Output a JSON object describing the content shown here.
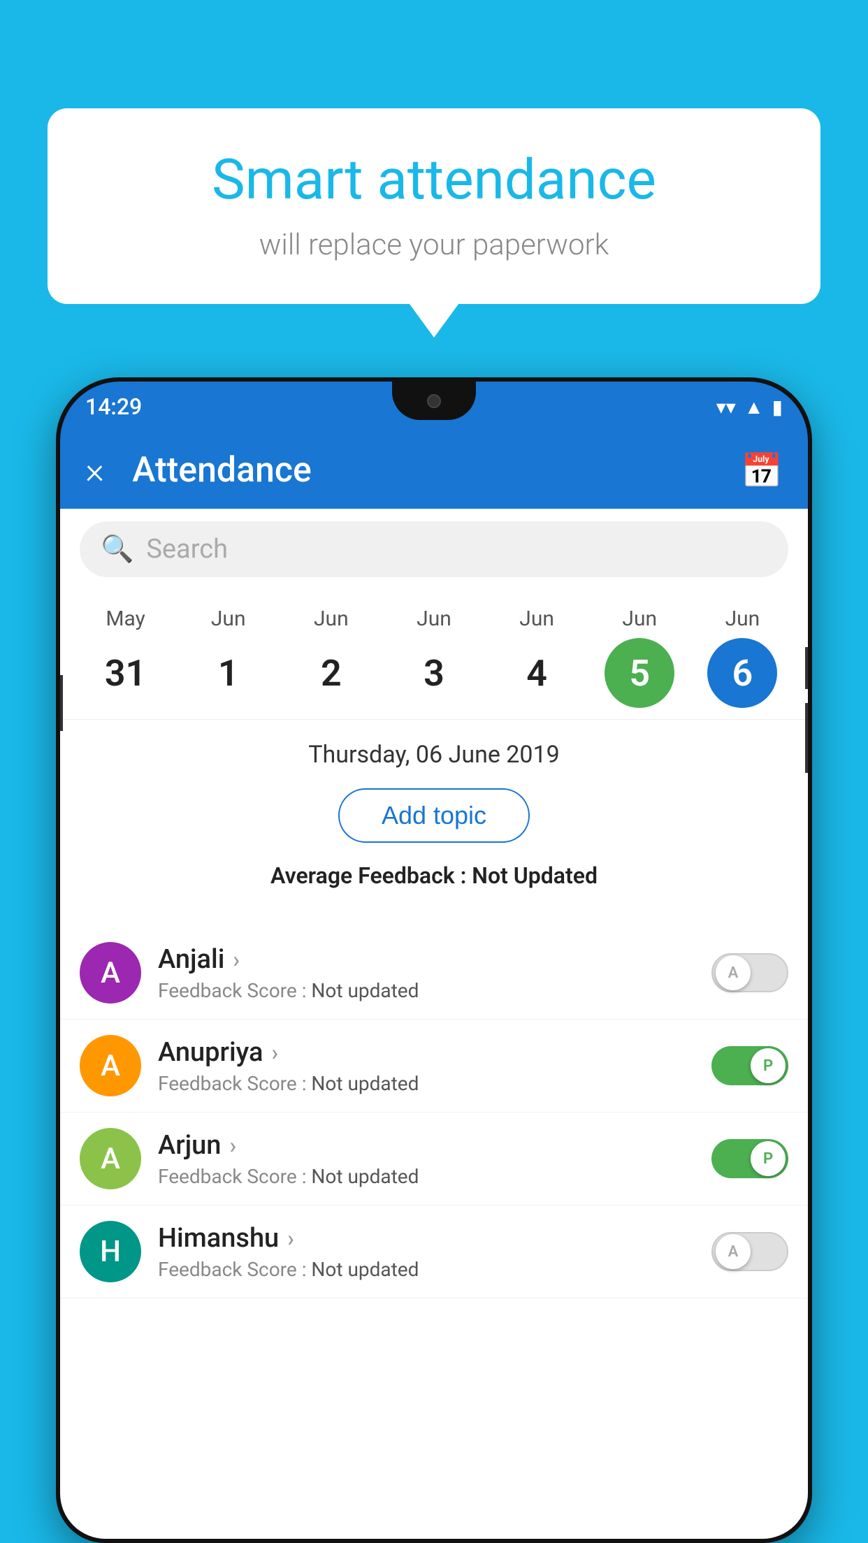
{
  "background_color": "#1ab8e8",
  "bubble": {
    "title": "Smart attendance",
    "subtitle": "will replace your paperwork"
  },
  "status_bar": {
    "time": "14:29",
    "icons": [
      "wifi",
      "signal",
      "battery"
    ]
  },
  "app_bar": {
    "close_label": "×",
    "title": "Attendance",
    "calendar_icon": "📅"
  },
  "search": {
    "placeholder": "Search"
  },
  "calendar": {
    "days": [
      {
        "month": "May",
        "date": "31",
        "state": "normal"
      },
      {
        "month": "Jun",
        "date": "1",
        "state": "normal"
      },
      {
        "month": "Jun",
        "date": "2",
        "state": "normal"
      },
      {
        "month": "Jun",
        "date": "3",
        "state": "normal"
      },
      {
        "month": "Jun",
        "date": "4",
        "state": "normal"
      },
      {
        "month": "Jun",
        "date": "5",
        "state": "today"
      },
      {
        "month": "Jun",
        "date": "6",
        "state": "selected"
      }
    ]
  },
  "selected_date": "Thursday, 06 June 2019",
  "add_topic_label": "Add topic",
  "avg_feedback_label": "Average Feedback :",
  "avg_feedback_value": "Not Updated",
  "students": [
    {
      "name": "Anjali",
      "avatar_letter": "A",
      "avatar_color": "purple",
      "feedback_label": "Feedback Score :",
      "feedback_value": "Not updated",
      "toggle_state": "off",
      "toggle_label": "A"
    },
    {
      "name": "Anupriya",
      "avatar_letter": "A",
      "avatar_color": "orange",
      "feedback_label": "Feedback Score :",
      "feedback_value": "Not updated",
      "toggle_state": "on",
      "toggle_label": "P"
    },
    {
      "name": "Arjun",
      "avatar_letter": "A",
      "avatar_color": "green",
      "feedback_label": "Feedback Score :",
      "feedback_value": "Not updated",
      "toggle_state": "on",
      "toggle_label": "P"
    },
    {
      "name": "Himanshu",
      "avatar_letter": "H",
      "avatar_color": "teal",
      "feedback_label": "Feedback Score :",
      "feedback_value": "Not updated",
      "toggle_state": "off",
      "toggle_label": "A"
    }
  ]
}
